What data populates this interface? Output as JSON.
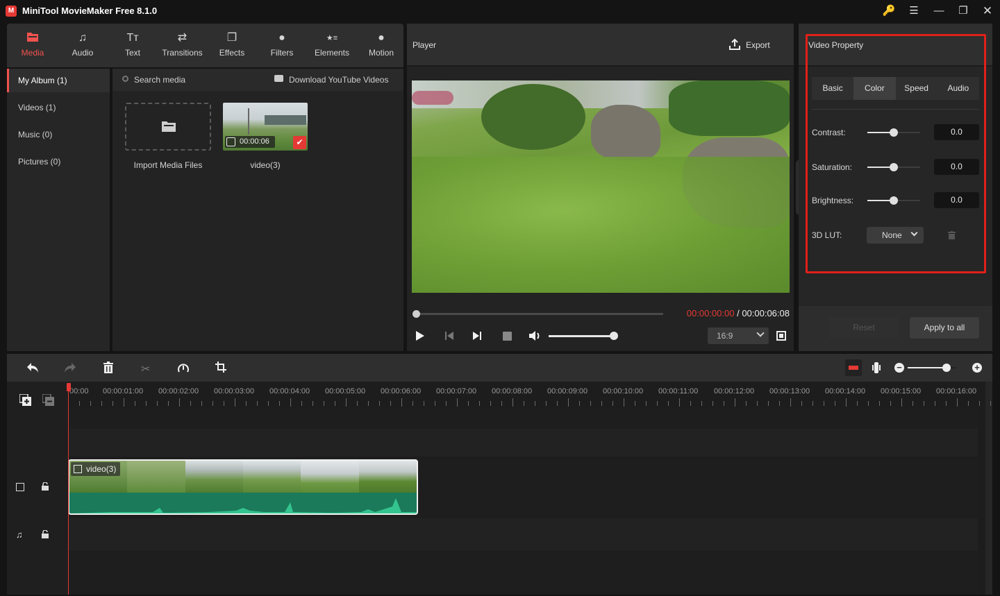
{
  "app": {
    "title": "MiniTool MovieMaker Free 8.1.0",
    "logo": "M",
    "window_controls": {
      "key": "🔑",
      "menu": "☰",
      "minimize": "—",
      "maximize": "❐",
      "close": "✕"
    },
    "accent_color": "#f0524f"
  },
  "toolbar": {
    "items": [
      {
        "label": "Media",
        "icon": "folder-icon",
        "glyph": "▬",
        "active": true
      },
      {
        "label": "Audio",
        "icon": "music-note-icon",
        "glyph": "♫"
      },
      {
        "label": "Text",
        "icon": "text-icon",
        "glyph": "Tт"
      },
      {
        "label": "Transitions",
        "icon": "swap-arrows-icon",
        "glyph": "⇄"
      },
      {
        "label": "Effects",
        "icon": "effects-layers-icon",
        "glyph": "❐"
      },
      {
        "label": "Filters",
        "icon": "filters-circles-icon",
        "glyph": "●"
      },
      {
        "label": "Elements",
        "icon": "elements-star-icon",
        "glyph": "★≡"
      },
      {
        "label": "Motion",
        "icon": "motion-ball-icon",
        "glyph": "●"
      }
    ]
  },
  "sidebar": {
    "items": [
      {
        "label": "My Album (1)",
        "active": true
      },
      {
        "label": "Videos (1)"
      },
      {
        "label": "Music (0)"
      },
      {
        "label": "Pictures (0)"
      }
    ]
  },
  "media": {
    "search_placeholder": "Search media",
    "download_label": "Download YouTube Videos",
    "import_label": "Import Media Files",
    "items": [
      {
        "name": "video(3)",
        "duration": "00:00:06",
        "selected": true
      }
    ]
  },
  "player": {
    "title": "Player",
    "export_label": "Export",
    "current_time": "00:00:00:00",
    "separator": " / ",
    "total_time": "00:00:06:08",
    "progress": 0,
    "volume": 1.0,
    "aspect_ratio": "16:9"
  },
  "property": {
    "title": "Video Property",
    "tabs": [
      {
        "label": "Basic"
      },
      {
        "label": "Color",
        "active": true
      },
      {
        "label": "Speed"
      },
      {
        "label": "Audio"
      }
    ],
    "rows": [
      {
        "label": "Contrast:",
        "value": "0.0",
        "position": 0.5
      },
      {
        "label": "Saturation:",
        "value": "0.0",
        "position": 0.5
      },
      {
        "label": "Brightness:",
        "value": "0.0",
        "position": 0.5
      }
    ],
    "lut_label": "3D LUT:",
    "lut_value": "None",
    "reset_label": "Reset",
    "apply_all_label": "Apply to all"
  },
  "timeline": {
    "ruler": [
      "00:00",
      "00:00:01:00",
      "00:00:02:00",
      "00:00:03:00",
      "00:00:04:00",
      "00:00:05:00",
      "00:00:06:00",
      "00:00:07:00",
      "00:00:08:00",
      "00:00:09:00",
      "00:00:10:00",
      "00:00:11:00",
      "00:00:12:00",
      "00:00:13:00",
      "00:00:14:00",
      "00:00:15:00",
      "00:00:16:00"
    ],
    "zoom_level": 0.8,
    "clip": {
      "name": "video(3)"
    }
  }
}
